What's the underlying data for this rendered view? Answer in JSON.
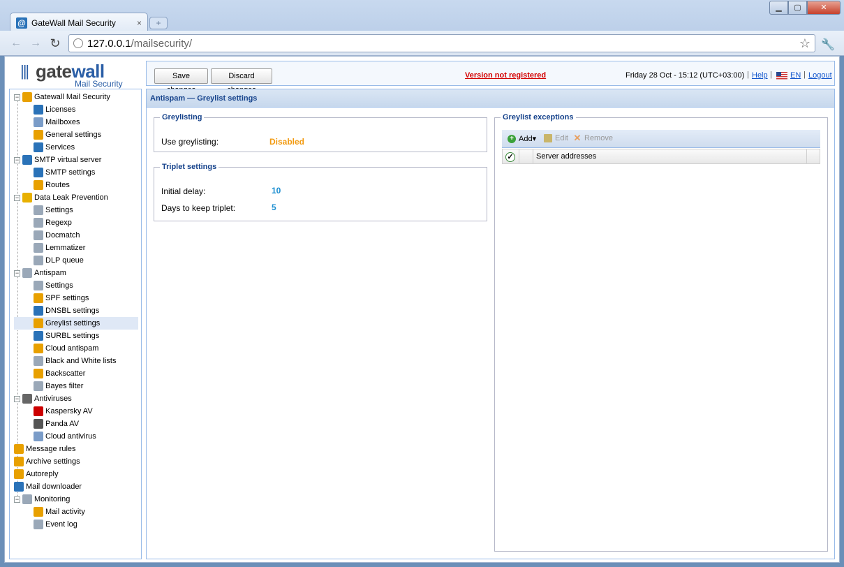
{
  "browser": {
    "tab_title": "GateWall Mail Security",
    "tab_close": "×",
    "new_tab": "+",
    "url_host": "127.0.0.1",
    "url_path": "/mailsecurity/",
    "window_controls": {
      "minimize": "▁",
      "maximize": "▢",
      "close": "✕"
    }
  },
  "logo": {
    "brand_gate": "gate",
    "brand_wall": "wall",
    "subtitle": "Mail Security"
  },
  "topbar": {
    "save_label": "Save changes",
    "discard_label": "Discard changes",
    "unregistered": "Version not registered",
    "datetime": "Friday 28 Oct - 15:12 (UTC+03:00)",
    "help": "Help",
    "language": "EN",
    "logout": "Logout"
  },
  "sidebar": {
    "items": [
      {
        "label": "Gatewall Mail Security",
        "level": 0,
        "icon": "shield-icon",
        "color": "#e8a000",
        "toggle": "−"
      },
      {
        "label": "Licenses",
        "level": 1,
        "icon": "info-icon",
        "color": "#2a72b8"
      },
      {
        "label": "Mailboxes",
        "level": 1,
        "icon": "mailbox-icon",
        "color": "#7a9cc8"
      },
      {
        "label": "General settings",
        "level": 1,
        "icon": "settings-icon",
        "color": "#e8a000"
      },
      {
        "label": "Services",
        "level": 1,
        "icon": "services-icon",
        "color": "#2a72b8"
      },
      {
        "label": "SMTP virtual server",
        "level": 0,
        "icon": "at-icon",
        "color": "#2a72b8",
        "toggle": "−"
      },
      {
        "label": "SMTP settings",
        "level": 1,
        "icon": "at-icon",
        "color": "#2a72b8"
      },
      {
        "label": "Routes",
        "level": 1,
        "icon": "routes-icon",
        "color": "#e8a000"
      },
      {
        "label": "Data Leak Prevention",
        "level": 0,
        "icon": "dlp-icon",
        "color": "#e8b000",
        "toggle": "−"
      },
      {
        "label": "Settings",
        "level": 1,
        "icon": "settings-icon",
        "color": "#9aa8b8"
      },
      {
        "label": "Regexp",
        "level": 1,
        "icon": "regexp-icon",
        "color": "#9aa8b8"
      },
      {
        "label": "Docmatch",
        "level": 1,
        "icon": "docmatch-icon",
        "color": "#9aa8b8"
      },
      {
        "label": "Lemmatizer",
        "level": 1,
        "icon": "lemmatizer-icon",
        "color": "#9aa8b8"
      },
      {
        "label": "DLP queue",
        "level": 1,
        "icon": "queue-icon",
        "color": "#9aa8b8"
      },
      {
        "label": "Antispam",
        "level": 0,
        "icon": "antispam-icon",
        "color": "#9aa8b8",
        "toggle": "−"
      },
      {
        "label": "Settings",
        "level": 1,
        "icon": "settings-icon",
        "color": "#9aa8b8"
      },
      {
        "label": "SPF settings",
        "level": 1,
        "icon": "spf-icon",
        "color": "#e8a000"
      },
      {
        "label": "DNSBL settings",
        "level": 1,
        "icon": "dnsbl-icon",
        "color": "#2a72b8"
      },
      {
        "label": "Greylist settings",
        "level": 1,
        "icon": "greylist-icon",
        "color": "#e8a000",
        "selected": true
      },
      {
        "label": "SURBL settings",
        "level": 1,
        "icon": "surbl-icon",
        "color": "#2a72b8"
      },
      {
        "label": "Cloud antispam",
        "level": 1,
        "icon": "cloud-icon",
        "color": "#e8a000"
      },
      {
        "label": "Black and White lists",
        "level": 1,
        "icon": "list-icon",
        "color": "#9aa8b8"
      },
      {
        "label": "Backscatter",
        "level": 1,
        "icon": "backscatter-icon",
        "color": "#e8a000"
      },
      {
        "label": "Bayes filter",
        "level": 1,
        "icon": "bayes-icon",
        "color": "#9aa8b8"
      },
      {
        "label": "Antiviruses",
        "level": 0,
        "icon": "antivirus-icon",
        "color": "#666666",
        "toggle": "−"
      },
      {
        "label": "Kaspersky AV",
        "level": 1,
        "icon": "kaspersky-icon",
        "color": "#cc0000"
      },
      {
        "label": "Panda AV",
        "level": 1,
        "icon": "panda-icon",
        "color": "#555555"
      },
      {
        "label": "Cloud antivirus",
        "level": 1,
        "icon": "cloud-antivirus-icon",
        "color": "#7a9cc8"
      },
      {
        "label": "Message rules",
        "level": 0,
        "icon": "rules-icon",
        "color": "#e8a000"
      },
      {
        "label": "Archive settings",
        "level": 0,
        "icon": "archive-icon",
        "color": "#e8a000"
      },
      {
        "label": "Autoreply",
        "level": 0,
        "icon": "autoreply-icon",
        "color": "#e8a000"
      },
      {
        "label": "Mail downloader",
        "level": 0,
        "icon": "downloader-icon",
        "color": "#2a72b8"
      },
      {
        "label": "Monitoring",
        "level": 0,
        "icon": "monitoring-icon",
        "color": "#9aa8b8",
        "toggle": "−"
      },
      {
        "label": "Mail activity",
        "level": 1,
        "icon": "activity-icon",
        "color": "#e8a000"
      },
      {
        "label": "Event log",
        "level": 1,
        "icon": "log-icon",
        "color": "#9aa8b8"
      }
    ]
  },
  "main": {
    "title": "Antispam — Greylist settings",
    "greylisting": {
      "legend": "Greylisting",
      "use_label": "Use greylisting:",
      "use_value": "Disabled"
    },
    "triplet": {
      "legend": "Triplet settings",
      "delay_label": "Initial delay:",
      "delay_value": "10",
      "days_label": "Days to keep triplet:",
      "days_value": "5"
    },
    "exceptions": {
      "legend": "Greylist exceptions",
      "add": "Add",
      "edit": "Edit",
      "remove": "Remove",
      "column": "Server addresses"
    }
  }
}
